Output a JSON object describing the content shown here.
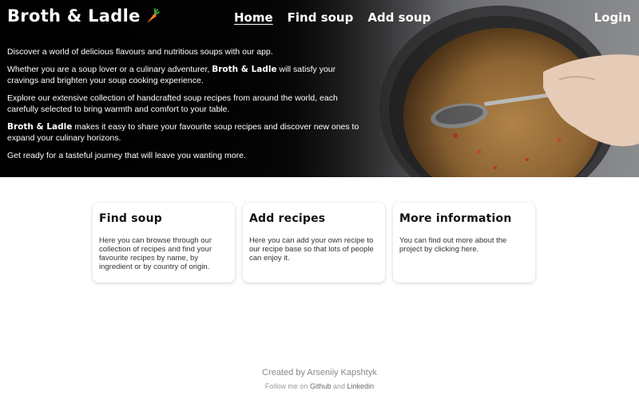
{
  "header": {
    "brand": "Broth & Ladle",
    "nav": [
      "Home",
      "Find soup",
      "Add soup"
    ],
    "login": "Login"
  },
  "intro": {
    "p1": "Discover a world of delicious flavours and nutritious soups with our app.",
    "p2_before": "Whether you are a soup lover or a culinary adventurer,",
    "p2_brand": "Broth & Ladle",
    "p2_after": "will satisfy your cravings and brighten your soup cooking experience.",
    "p3": "Explore our extensive collection of handcrafted soup recipes from around the world, each carefully selected to bring warmth and comfort to your table.",
    "p4_brand": "Broth & Ladle",
    "p4_after": "makes it easy to share your favourite soup recipes and discover new ones to expand your culinary horizons.",
    "p5": "Get ready for a tasteful journey that will leave you wanting more."
  },
  "cards": [
    {
      "title": "Find soup",
      "text": "Here you can browse through our collection of recipes and find your favourite recipes by name, by ingredient or by country of origin."
    },
    {
      "title": "Add recipes",
      "text": "Here you can add your own recipe to our recipe base so that lots of people can enjoy it."
    },
    {
      "title": "More information",
      "text": "You can find out more about the project by clicking here."
    }
  ],
  "footer": {
    "created": "Created by Arseniiy Kapshtyk",
    "follow_prefix": "Follow me on",
    "github": "Github",
    "and": "and",
    "linkedin": "Linkedin"
  },
  "icons": {
    "brand_icon": "carrot-icon",
    "hero_image": "soup-pot-image"
  }
}
